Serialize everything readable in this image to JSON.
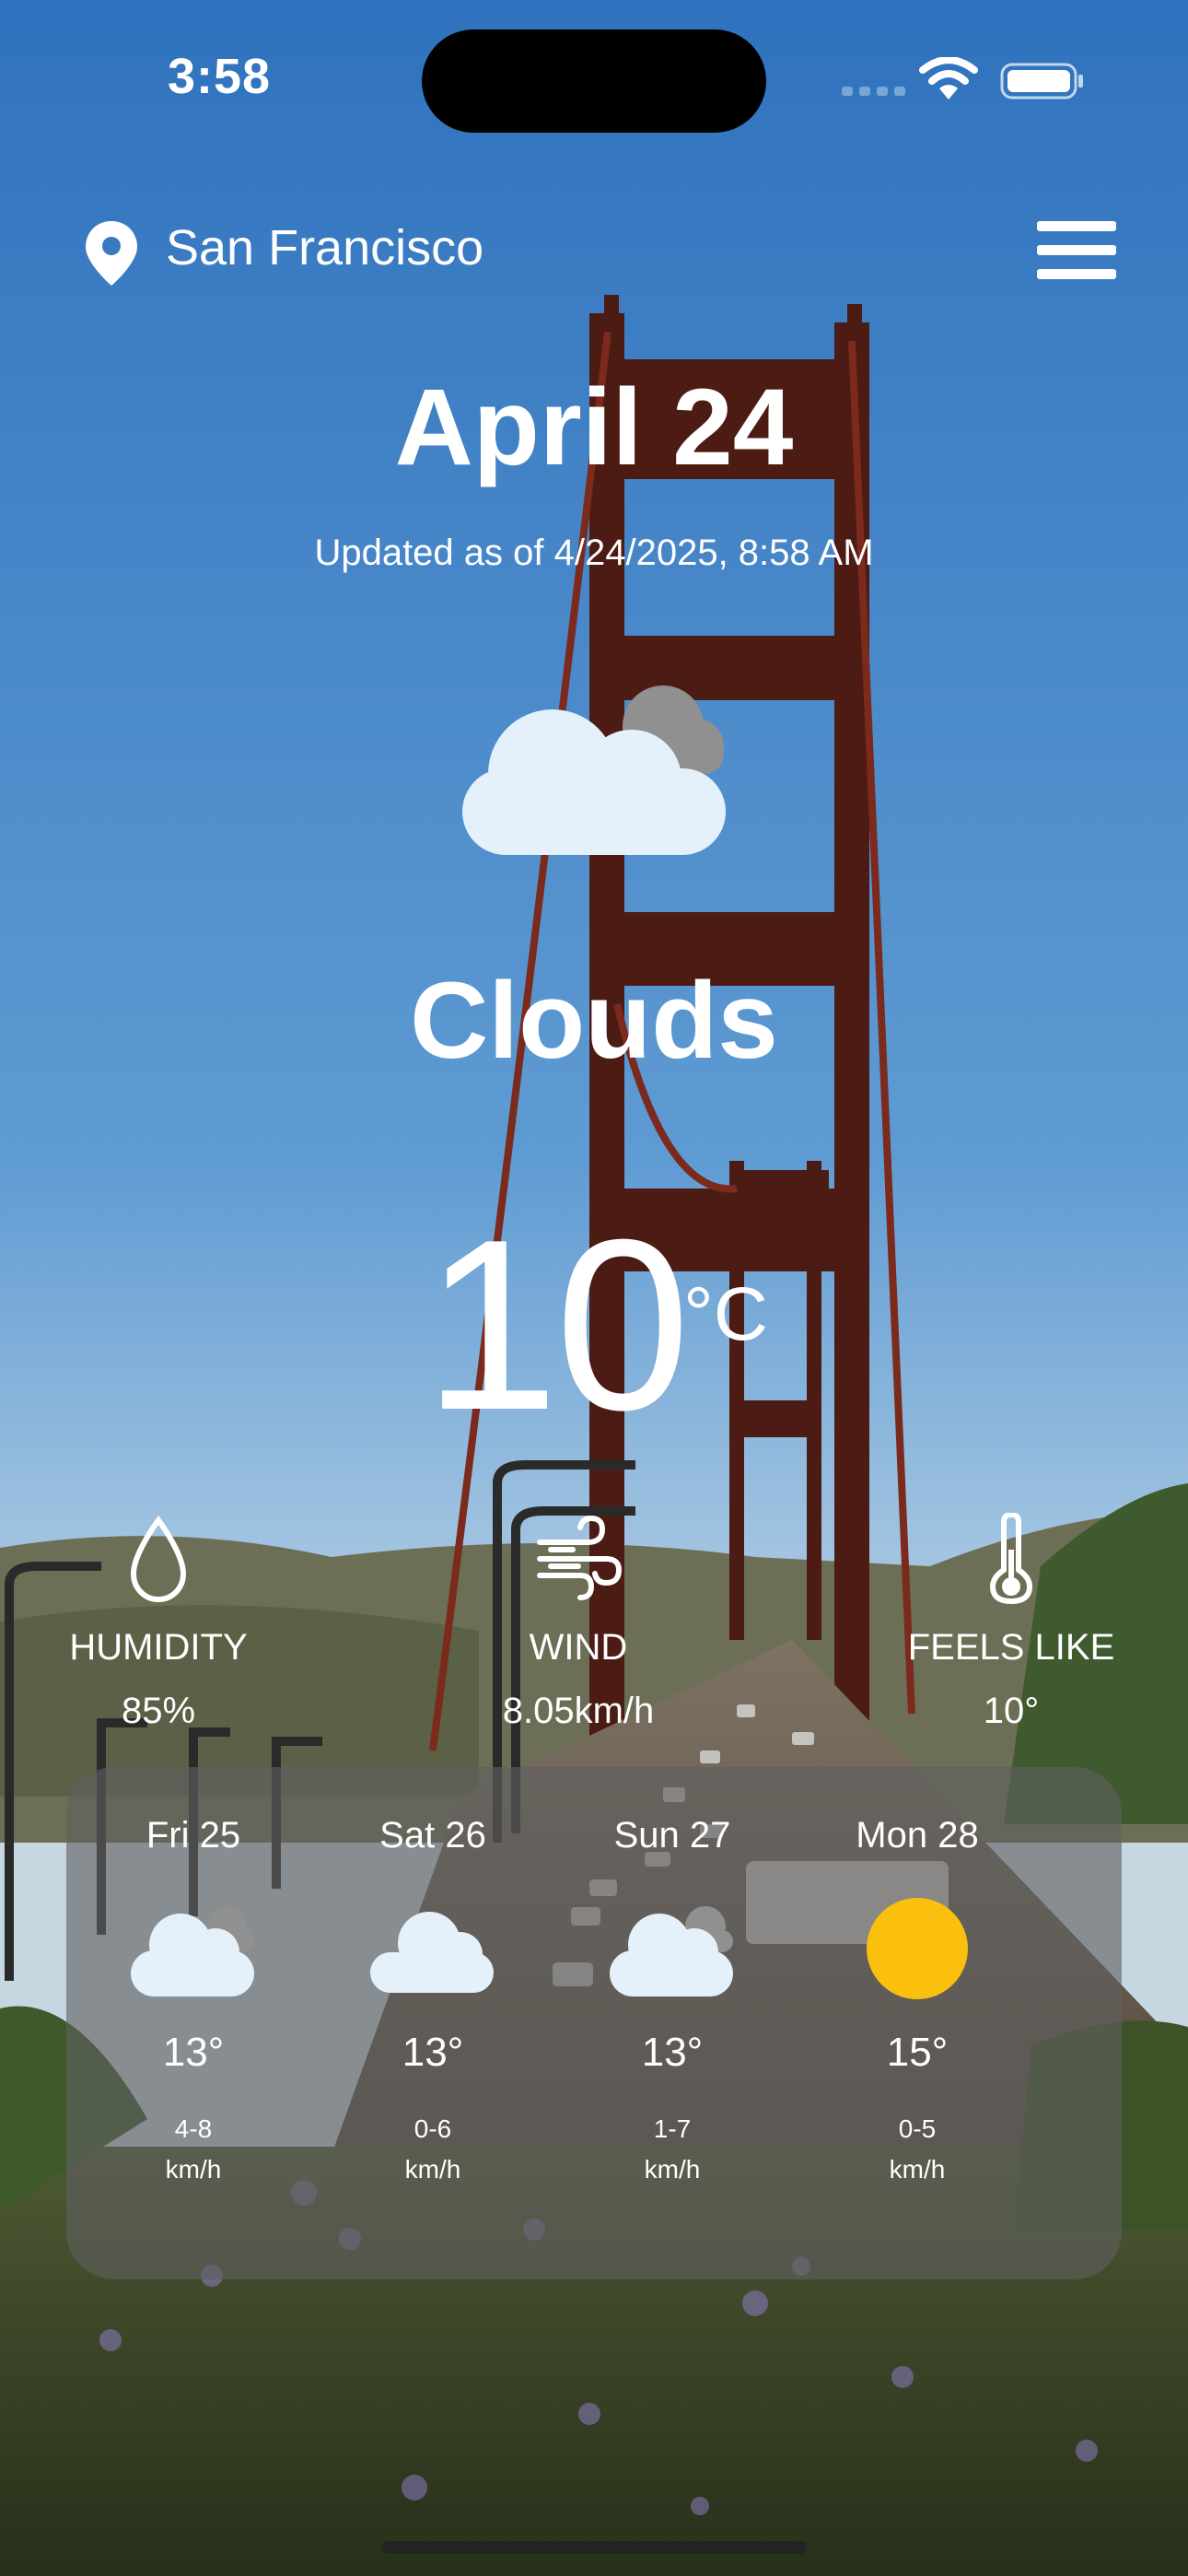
{
  "status_bar": {
    "time": "3:58"
  },
  "header": {
    "city": "San Francisco"
  },
  "current": {
    "date": "April 24",
    "updated": "Updated as of 4/24/2025, 8:58 AM",
    "condition": "Clouds",
    "icon": "clouds-icon",
    "temperature": "10",
    "unit": "°C"
  },
  "stats": {
    "humidity": {
      "label": "HUMIDITY",
      "value": "85%",
      "icon": "droplet-icon"
    },
    "wind": {
      "label": "WIND",
      "value": "8.05km/h",
      "icon": "wind-icon"
    },
    "feels_like": {
      "label": "FEELS LIKE",
      "value": "10°",
      "icon": "thermometer-icon"
    }
  },
  "forecast": [
    {
      "day": "Fri 25",
      "icon": "clouds-icon",
      "temp": "13°",
      "wind": "4-8",
      "wind_unit": "km/h"
    },
    {
      "day": "Sat 26",
      "icon": "cloud-icon",
      "temp": "13°",
      "wind": "0-6",
      "wind_unit": "km/h"
    },
    {
      "day": "Sun 27",
      "icon": "clouds-icon",
      "temp": "13°",
      "wind": "1-7",
      "wind_unit": "km/h"
    },
    {
      "day": "Mon 28",
      "icon": "sun-icon",
      "temp": "15°",
      "wind": "0-5",
      "wind_unit": "km/h"
    }
  ],
  "colors": {
    "sky_top": "#3b82c9",
    "sky_bottom": "#c9dcea",
    "bridge": "#5a1f17",
    "sun": "#fbbf0e",
    "card": "#5f5f5f"
  }
}
